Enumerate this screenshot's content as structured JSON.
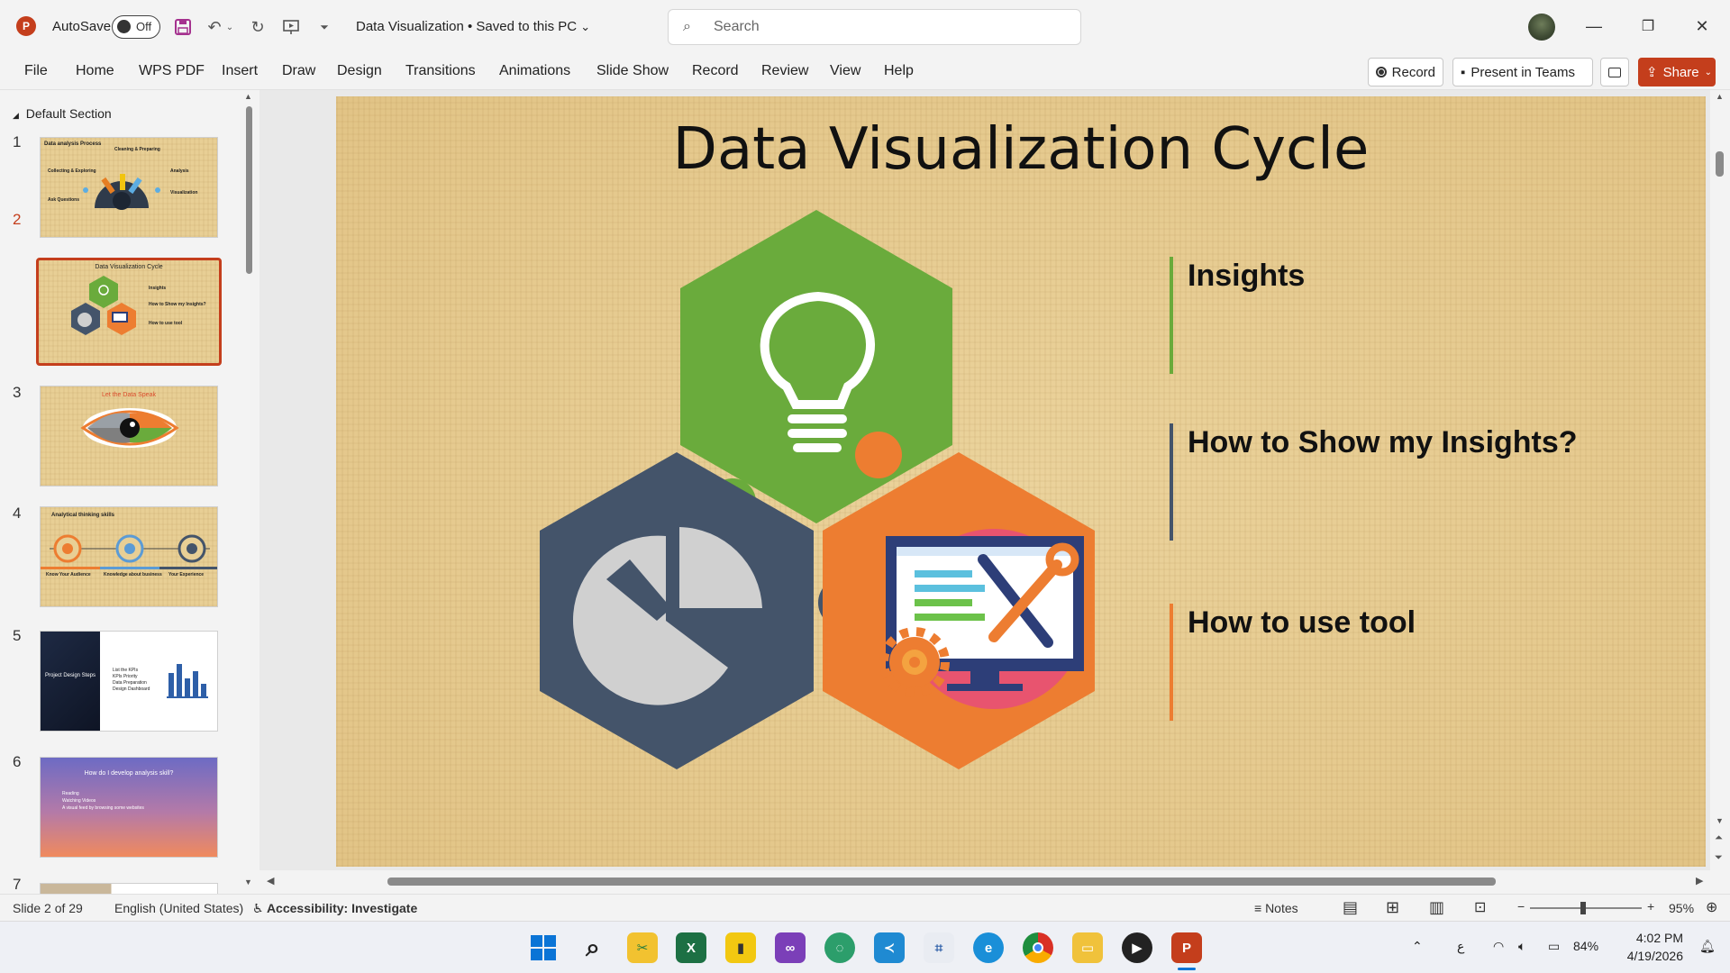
{
  "titlebar": {
    "app_icon": "powerpoint-icon",
    "autosave_label": "AutoSave",
    "autosave_state": "Off",
    "doc_title": "Data Visualization • Saved to this PC",
    "search_placeholder": "Search"
  },
  "ribbon": {
    "tabs": [
      "File",
      "Home",
      "WPS PDF",
      "Insert",
      "Draw",
      "Design",
      "Transitions",
      "Animations",
      "Slide Show",
      "Record",
      "Review",
      "View",
      "Help"
    ],
    "record_label": "Record",
    "present_label": "Present in Teams",
    "share_label": "Share"
  },
  "thumbnails": {
    "section_label": "Default Section",
    "numbers": [
      "1",
      "2",
      "3",
      "4",
      "5",
      "6",
      "7"
    ],
    "t1_title": "Data analysis Process",
    "t1_labels": [
      "Cleaning & Preparing",
      "Collecting & Exploring",
      "Analysis",
      "Ask Questions",
      "Visualization"
    ],
    "t2_title": "Data Visualization Cycle",
    "t2_items": [
      "Insights",
      "How to Show my Insights?",
      "How to use tool"
    ],
    "t3_title": "Let the Data Speak",
    "t4_title": "Analytical thinking skills",
    "t4_labels": [
      "Know Your Audience",
      "Knowledge about business",
      "Your Experience"
    ],
    "t5_title": "Project Design Steps",
    "t5_items": [
      "List the KPIs",
      "KPIs Priority",
      "Data Preparation",
      "Design Dashboard"
    ],
    "t6_title": "How do I develop analysis skill?",
    "t6_items": [
      "Reading",
      "Watching Videos",
      "A visual feed by browsing some websites"
    ]
  },
  "slide": {
    "title": "Data Visualization Cycle",
    "items": [
      {
        "label": "Insights",
        "color": "#6aaa3a"
      },
      {
        "label": "How to Show my Insights?",
        "color": "#44546a"
      },
      {
        "label": "How to use tool",
        "color": "#ed7d31"
      }
    ],
    "colors": {
      "green": "#6aab3c",
      "navy": "#44546a",
      "orange": "#ed7d31",
      "pink": "#e8546f"
    }
  },
  "statusbar": {
    "slide_counter": "Slide 2 of 29",
    "language": "English (United States)",
    "accessibility": "Accessibility: Investigate",
    "notes": "Notes",
    "zoom": "95%"
  },
  "taskbar": {
    "battery": "84%",
    "time": "4:02 PM",
    "date": "4/19/2026",
    "lang_indicator": "ع"
  }
}
